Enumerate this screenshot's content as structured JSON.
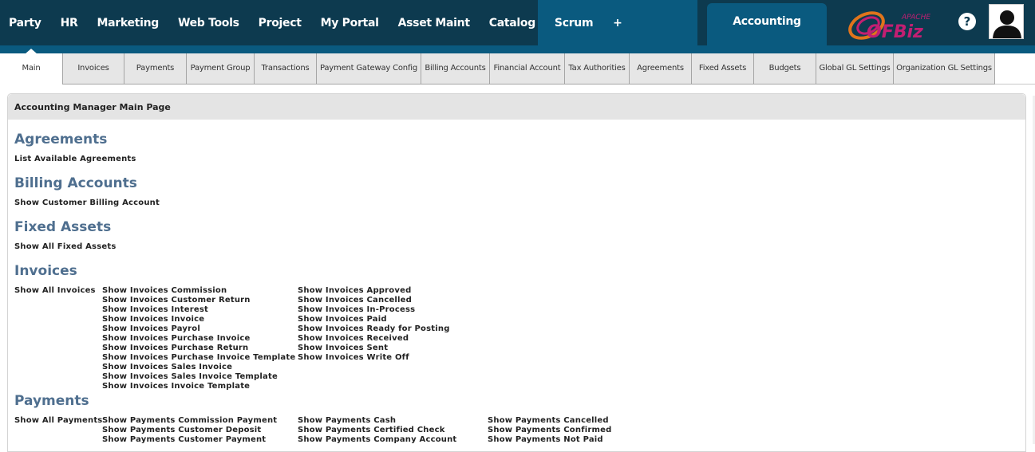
{
  "top_nav": {
    "items": [
      "Party",
      "HR",
      "Marketing",
      "Web Tools",
      "Project",
      "My Portal",
      "Asset Maint",
      "Catalog",
      "Scrum"
    ],
    "plus_label": "+",
    "active_app": "Accounting",
    "logo_apache": "APACHE",
    "logo_text": "OFBiz",
    "help_label": "?"
  },
  "sub_menu": {
    "items": [
      "Main",
      "Invoices",
      "Payments",
      "Payment Group",
      "Transactions",
      "Payment Gateway Config",
      "Billing Accounts",
      "Financial Account",
      "Tax Authorities",
      "Agreements",
      "Fixed Assets",
      "Budgets",
      "Global GL Settings",
      "Organization GL Settings"
    ],
    "active": "Main"
  },
  "panel": {
    "title": "Accounting Manager Main Page"
  },
  "sections": {
    "agreements": {
      "title": "Agreements",
      "links": [
        "List Available Agreements"
      ]
    },
    "billing": {
      "title": "Billing Accounts",
      "links": [
        "Show Customer Billing Account"
      ]
    },
    "fixed_assets": {
      "title": "Fixed Assets",
      "links": [
        "Show All Fixed Assets"
      ]
    },
    "invoices": {
      "title": "Invoices",
      "col1": [
        "Show All Invoices"
      ],
      "col2": [
        "Show Invoices Commission",
        "Show Invoices Customer Return",
        "Show Invoices Interest",
        "Show Invoices Invoice",
        "Show Invoices Payrol",
        "Show Invoices Purchase Invoice",
        "Show Invoices Purchase Return",
        "Show Invoices Purchase Invoice Template",
        "Show Invoices Sales Invoice",
        "Show Invoices Sales Invoice Template",
        "Show Invoices Invoice Template"
      ],
      "col3": [
        "Show Invoices Approved",
        "Show Invoices Cancelled",
        "Show Invoices In-Process",
        "Show Invoices Paid",
        "Show Invoices Ready for Posting",
        "Show Invoices Received",
        "Show Invoices Sent",
        "Show Invoices Write Off"
      ]
    },
    "payments": {
      "title": "Payments",
      "col1": [
        "Show All Payments"
      ],
      "col2": [
        "Show Payments Commission Payment",
        "Show Payments Customer Deposit",
        "Show Payments Customer Payment"
      ],
      "col3": [
        "Show Payments Cash",
        "Show Payments Certified Check",
        "Show Payments Company Account"
      ],
      "col4": [
        "Show Payments Cancelled",
        "Show Payments Confirmed",
        "Show Payments Not Paid"
      ]
    }
  }
}
